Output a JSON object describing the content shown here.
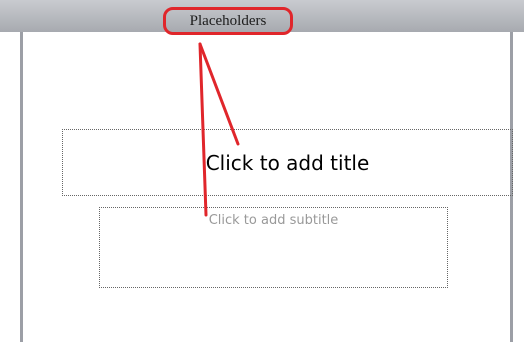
{
  "callout": {
    "label": "Placeholders"
  },
  "slide": {
    "title_placeholder": "Click to add title",
    "subtitle_placeholder": "Click to add subtitle"
  },
  "colors": {
    "annotation_red": "#e0262b",
    "frame_gray": "#9c9fa6"
  }
}
